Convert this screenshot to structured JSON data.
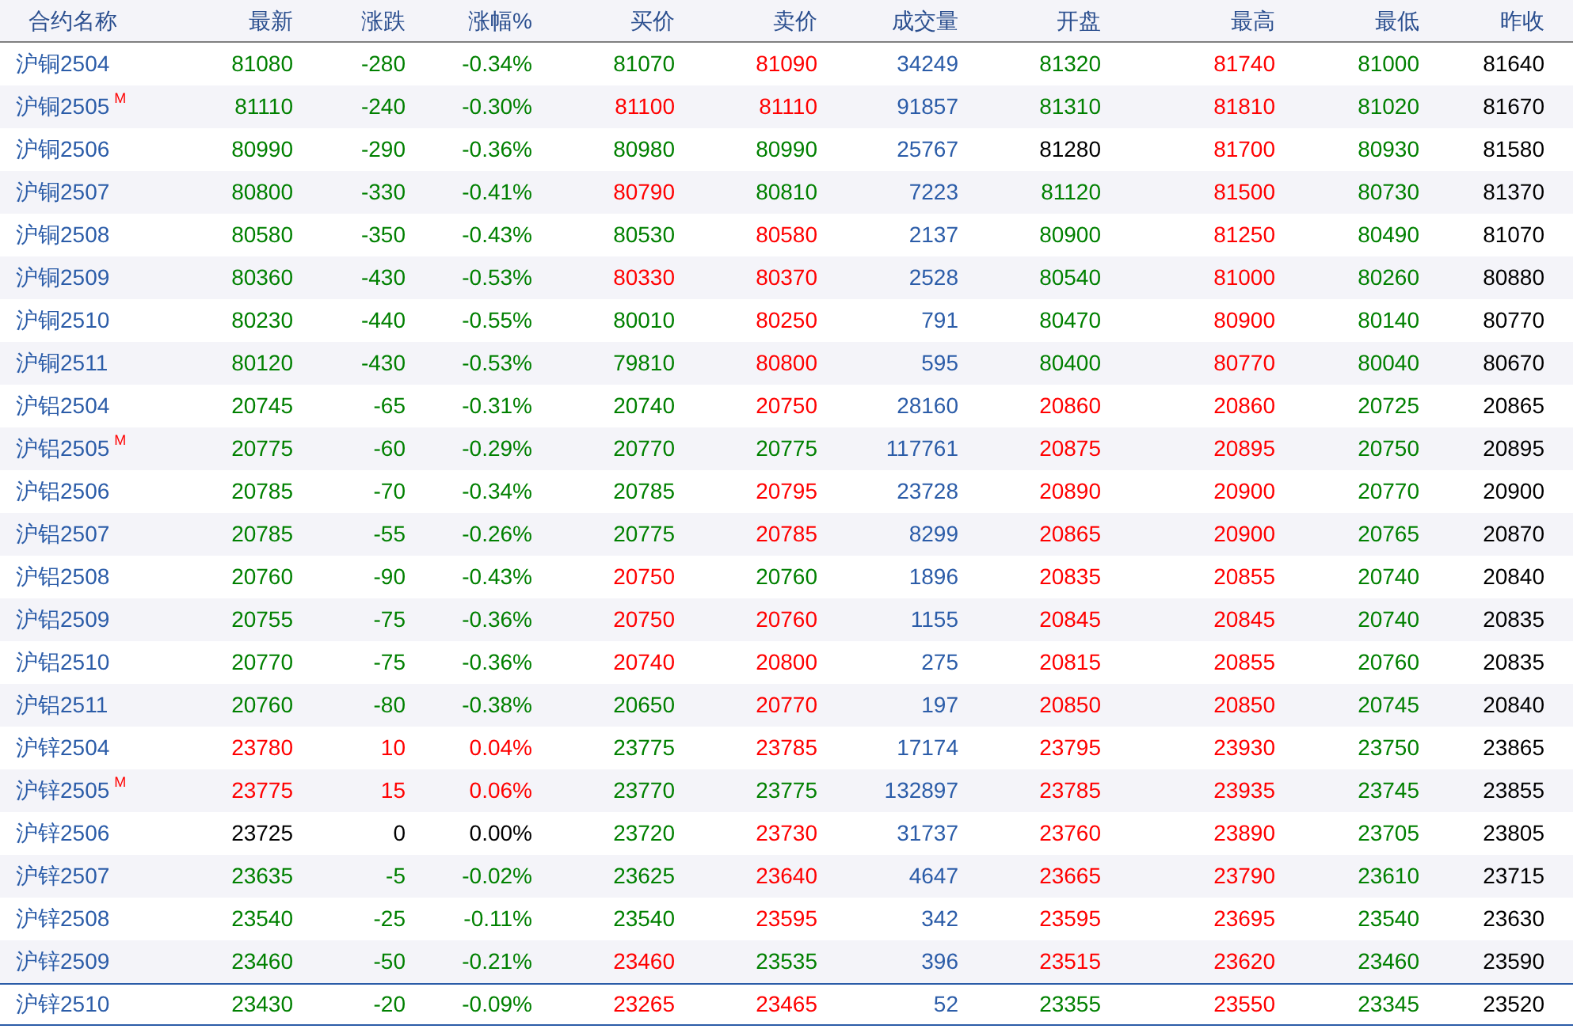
{
  "table": {
    "columns": [
      "合约名称",
      "最新",
      "涨跌",
      "涨幅%",
      "买价",
      "卖价",
      "成交量",
      "开盘",
      "最高",
      "最低",
      "昨收"
    ],
    "rows": [
      {
        "selected": false,
        "cells": [
          {
            "text": "沪铜2504"
          },
          {
            "text": "81080",
            "color": "#008000"
          },
          {
            "text": "-280",
            "color": "#008000"
          },
          {
            "text": "-0.34%",
            "color": "#008000"
          },
          {
            "text": "81070",
            "color": "#008000"
          },
          {
            "text": "81090",
            "color": "#ff0000"
          },
          {
            "text": "34249",
            "color": "#2b5ca8"
          },
          {
            "text": "81320",
            "color": "#008000"
          },
          {
            "text": "81740",
            "color": "#ff0000"
          },
          {
            "text": "81000",
            "color": "#008000"
          },
          {
            "text": "81640",
            "color": "#000000"
          }
        ]
      },
      {
        "selected": false,
        "cells": [
          {
            "text": "沪铜2505",
            "mark": "M"
          },
          {
            "text": "81110",
            "color": "#008000"
          },
          {
            "text": "-240",
            "color": "#008000"
          },
          {
            "text": "-0.30%",
            "color": "#008000"
          },
          {
            "text": "81100",
            "color": "#ff0000"
          },
          {
            "text": "81110",
            "color": "#ff0000"
          },
          {
            "text": "91857",
            "color": "#2b5ca8"
          },
          {
            "text": "81310",
            "color": "#008000"
          },
          {
            "text": "81810",
            "color": "#ff0000"
          },
          {
            "text": "81020",
            "color": "#008000"
          },
          {
            "text": "81670",
            "color": "#000000"
          }
        ]
      },
      {
        "selected": false,
        "cells": [
          {
            "text": "沪铜2506"
          },
          {
            "text": "80990",
            "color": "#008000"
          },
          {
            "text": "-290",
            "color": "#008000"
          },
          {
            "text": "-0.36%",
            "color": "#008000"
          },
          {
            "text": "80980",
            "color": "#008000"
          },
          {
            "text": "80990",
            "color": "#008000"
          },
          {
            "text": "25767",
            "color": "#2b5ca8"
          },
          {
            "text": "81280",
            "color": "#000000"
          },
          {
            "text": "81700",
            "color": "#ff0000"
          },
          {
            "text": "80930",
            "color": "#008000"
          },
          {
            "text": "81580",
            "color": "#000000"
          }
        ]
      },
      {
        "selected": false,
        "cells": [
          {
            "text": "沪铜2507"
          },
          {
            "text": "80800",
            "color": "#008000"
          },
          {
            "text": "-330",
            "color": "#008000"
          },
          {
            "text": "-0.41%",
            "color": "#008000"
          },
          {
            "text": "80790",
            "color": "#ff0000"
          },
          {
            "text": "80810",
            "color": "#008000"
          },
          {
            "text": "7223",
            "color": "#2b5ca8"
          },
          {
            "text": "81120",
            "color": "#008000"
          },
          {
            "text": "81500",
            "color": "#ff0000"
          },
          {
            "text": "80730",
            "color": "#008000"
          },
          {
            "text": "81370",
            "color": "#000000"
          }
        ]
      },
      {
        "selected": false,
        "cells": [
          {
            "text": "沪铜2508"
          },
          {
            "text": "80580",
            "color": "#008000"
          },
          {
            "text": "-350",
            "color": "#008000"
          },
          {
            "text": "-0.43%",
            "color": "#008000"
          },
          {
            "text": "80530",
            "color": "#008000"
          },
          {
            "text": "80580",
            "color": "#ff0000"
          },
          {
            "text": "2137",
            "color": "#2b5ca8"
          },
          {
            "text": "80900",
            "color": "#008000"
          },
          {
            "text": "81250",
            "color": "#ff0000"
          },
          {
            "text": "80490",
            "color": "#008000"
          },
          {
            "text": "81070",
            "color": "#000000"
          }
        ]
      },
      {
        "selected": false,
        "cells": [
          {
            "text": "沪铜2509"
          },
          {
            "text": "80360",
            "color": "#008000"
          },
          {
            "text": "-430",
            "color": "#008000"
          },
          {
            "text": "-0.53%",
            "color": "#008000"
          },
          {
            "text": "80330",
            "color": "#ff0000"
          },
          {
            "text": "80370",
            "color": "#ff0000"
          },
          {
            "text": "2528",
            "color": "#2b5ca8"
          },
          {
            "text": "80540",
            "color": "#008000"
          },
          {
            "text": "81000",
            "color": "#ff0000"
          },
          {
            "text": "80260",
            "color": "#008000"
          },
          {
            "text": "80880",
            "color": "#000000"
          }
        ]
      },
      {
        "selected": false,
        "cells": [
          {
            "text": "沪铜2510"
          },
          {
            "text": "80230",
            "color": "#008000"
          },
          {
            "text": "-440",
            "color": "#008000"
          },
          {
            "text": "-0.55%",
            "color": "#008000"
          },
          {
            "text": "80010",
            "color": "#008000"
          },
          {
            "text": "80250",
            "color": "#ff0000"
          },
          {
            "text": "791",
            "color": "#2b5ca8"
          },
          {
            "text": "80470",
            "color": "#008000"
          },
          {
            "text": "80900",
            "color": "#ff0000"
          },
          {
            "text": "80140",
            "color": "#008000"
          },
          {
            "text": "80770",
            "color": "#000000"
          }
        ]
      },
      {
        "selected": false,
        "cells": [
          {
            "text": "沪铜2511"
          },
          {
            "text": "80120",
            "color": "#008000"
          },
          {
            "text": "-430",
            "color": "#008000"
          },
          {
            "text": "-0.53%",
            "color": "#008000"
          },
          {
            "text": "79810",
            "color": "#008000"
          },
          {
            "text": "80800",
            "color": "#ff0000"
          },
          {
            "text": "595",
            "color": "#2b5ca8"
          },
          {
            "text": "80400",
            "color": "#008000"
          },
          {
            "text": "80770",
            "color": "#ff0000"
          },
          {
            "text": "80040",
            "color": "#008000"
          },
          {
            "text": "80670",
            "color": "#000000"
          }
        ]
      },
      {
        "selected": false,
        "cells": [
          {
            "text": "沪铝2504"
          },
          {
            "text": "20745",
            "color": "#008000"
          },
          {
            "text": "-65",
            "color": "#008000"
          },
          {
            "text": "-0.31%",
            "color": "#008000"
          },
          {
            "text": "20740",
            "color": "#008000"
          },
          {
            "text": "20750",
            "color": "#ff0000"
          },
          {
            "text": "28160",
            "color": "#2b5ca8"
          },
          {
            "text": "20860",
            "color": "#ff0000"
          },
          {
            "text": "20860",
            "color": "#ff0000"
          },
          {
            "text": "20725",
            "color": "#008000"
          },
          {
            "text": "20865",
            "color": "#000000"
          }
        ]
      },
      {
        "selected": false,
        "cells": [
          {
            "text": "沪铝2505",
            "mark": "M"
          },
          {
            "text": "20775",
            "color": "#008000"
          },
          {
            "text": "-60",
            "color": "#008000"
          },
          {
            "text": "-0.29%",
            "color": "#008000"
          },
          {
            "text": "20770",
            "color": "#008000"
          },
          {
            "text": "20775",
            "color": "#008000"
          },
          {
            "text": "117761",
            "color": "#2b5ca8"
          },
          {
            "text": "20875",
            "color": "#ff0000"
          },
          {
            "text": "20895",
            "color": "#ff0000"
          },
          {
            "text": "20750",
            "color": "#008000"
          },
          {
            "text": "20895",
            "color": "#000000"
          }
        ]
      },
      {
        "selected": false,
        "cells": [
          {
            "text": "沪铝2506"
          },
          {
            "text": "20785",
            "color": "#008000"
          },
          {
            "text": "-70",
            "color": "#008000"
          },
          {
            "text": "-0.34%",
            "color": "#008000"
          },
          {
            "text": "20785",
            "color": "#008000"
          },
          {
            "text": "20795",
            "color": "#ff0000"
          },
          {
            "text": "23728",
            "color": "#2b5ca8"
          },
          {
            "text": "20890",
            "color": "#ff0000"
          },
          {
            "text": "20900",
            "color": "#ff0000"
          },
          {
            "text": "20770",
            "color": "#008000"
          },
          {
            "text": "20900",
            "color": "#000000"
          }
        ]
      },
      {
        "selected": false,
        "cells": [
          {
            "text": "沪铝2507"
          },
          {
            "text": "20785",
            "color": "#008000"
          },
          {
            "text": "-55",
            "color": "#008000"
          },
          {
            "text": "-0.26%",
            "color": "#008000"
          },
          {
            "text": "20775",
            "color": "#008000"
          },
          {
            "text": "20785",
            "color": "#ff0000"
          },
          {
            "text": "8299",
            "color": "#2b5ca8"
          },
          {
            "text": "20865",
            "color": "#ff0000"
          },
          {
            "text": "20900",
            "color": "#ff0000"
          },
          {
            "text": "20765",
            "color": "#008000"
          },
          {
            "text": "20870",
            "color": "#000000"
          }
        ]
      },
      {
        "selected": false,
        "cells": [
          {
            "text": "沪铝2508"
          },
          {
            "text": "20760",
            "color": "#008000"
          },
          {
            "text": "-90",
            "color": "#008000"
          },
          {
            "text": "-0.43%",
            "color": "#008000"
          },
          {
            "text": "20750",
            "color": "#ff0000"
          },
          {
            "text": "20760",
            "color": "#008000"
          },
          {
            "text": "1896",
            "color": "#2b5ca8"
          },
          {
            "text": "20835",
            "color": "#ff0000"
          },
          {
            "text": "20855",
            "color": "#ff0000"
          },
          {
            "text": "20740",
            "color": "#008000"
          },
          {
            "text": "20840",
            "color": "#000000"
          }
        ]
      },
      {
        "selected": false,
        "cells": [
          {
            "text": "沪铝2509"
          },
          {
            "text": "20755",
            "color": "#008000"
          },
          {
            "text": "-75",
            "color": "#008000"
          },
          {
            "text": "-0.36%",
            "color": "#008000"
          },
          {
            "text": "20750",
            "color": "#ff0000"
          },
          {
            "text": "20760",
            "color": "#ff0000"
          },
          {
            "text": "1155",
            "color": "#2b5ca8"
          },
          {
            "text": "20845",
            "color": "#ff0000"
          },
          {
            "text": "20845",
            "color": "#ff0000"
          },
          {
            "text": "20740",
            "color": "#008000"
          },
          {
            "text": "20835",
            "color": "#000000"
          }
        ]
      },
      {
        "selected": false,
        "cells": [
          {
            "text": "沪铝2510"
          },
          {
            "text": "20770",
            "color": "#008000"
          },
          {
            "text": "-75",
            "color": "#008000"
          },
          {
            "text": "-0.36%",
            "color": "#008000"
          },
          {
            "text": "20740",
            "color": "#ff0000"
          },
          {
            "text": "20800",
            "color": "#ff0000"
          },
          {
            "text": "275",
            "color": "#2b5ca8"
          },
          {
            "text": "20815",
            "color": "#ff0000"
          },
          {
            "text": "20855",
            "color": "#ff0000"
          },
          {
            "text": "20760",
            "color": "#008000"
          },
          {
            "text": "20835",
            "color": "#000000"
          }
        ]
      },
      {
        "selected": false,
        "cells": [
          {
            "text": "沪铝2511"
          },
          {
            "text": "20760",
            "color": "#008000"
          },
          {
            "text": "-80",
            "color": "#008000"
          },
          {
            "text": "-0.38%",
            "color": "#008000"
          },
          {
            "text": "20650",
            "color": "#008000"
          },
          {
            "text": "20770",
            "color": "#ff0000"
          },
          {
            "text": "197",
            "color": "#2b5ca8"
          },
          {
            "text": "20850",
            "color": "#ff0000"
          },
          {
            "text": "20850",
            "color": "#ff0000"
          },
          {
            "text": "20745",
            "color": "#008000"
          },
          {
            "text": "20840",
            "color": "#000000"
          }
        ]
      },
      {
        "selected": false,
        "cells": [
          {
            "text": "沪锌2504"
          },
          {
            "text": "23780",
            "color": "#ff0000"
          },
          {
            "text": "10",
            "color": "#ff0000"
          },
          {
            "text": "0.04%",
            "color": "#ff0000"
          },
          {
            "text": "23775",
            "color": "#008000"
          },
          {
            "text": "23785",
            "color": "#ff0000"
          },
          {
            "text": "17174",
            "color": "#2b5ca8"
          },
          {
            "text": "23795",
            "color": "#ff0000"
          },
          {
            "text": "23930",
            "color": "#ff0000"
          },
          {
            "text": "23750",
            "color": "#008000"
          },
          {
            "text": "23865",
            "color": "#000000"
          }
        ]
      },
      {
        "selected": false,
        "cells": [
          {
            "text": "沪锌2505",
            "mark": "M"
          },
          {
            "text": "23775",
            "color": "#ff0000"
          },
          {
            "text": "15",
            "color": "#ff0000"
          },
          {
            "text": "0.06%",
            "color": "#ff0000"
          },
          {
            "text": "23770",
            "color": "#008000"
          },
          {
            "text": "23775",
            "color": "#008000"
          },
          {
            "text": "132897",
            "color": "#2b5ca8"
          },
          {
            "text": "23785",
            "color": "#ff0000"
          },
          {
            "text": "23935",
            "color": "#ff0000"
          },
          {
            "text": "23745",
            "color": "#008000"
          },
          {
            "text": "23855",
            "color": "#000000"
          }
        ]
      },
      {
        "selected": false,
        "cells": [
          {
            "text": "沪锌2506"
          },
          {
            "text": "23725",
            "color": "#000000"
          },
          {
            "text": "0",
            "color": "#000000"
          },
          {
            "text": "0.00%",
            "color": "#000000"
          },
          {
            "text": "23720",
            "color": "#008000"
          },
          {
            "text": "23730",
            "color": "#ff0000"
          },
          {
            "text": "31737",
            "color": "#2b5ca8"
          },
          {
            "text": "23760",
            "color": "#ff0000"
          },
          {
            "text": "23890",
            "color": "#ff0000"
          },
          {
            "text": "23705",
            "color": "#008000"
          },
          {
            "text": "23805",
            "color": "#000000"
          }
        ]
      },
      {
        "selected": false,
        "cells": [
          {
            "text": "沪锌2507"
          },
          {
            "text": "23635",
            "color": "#008000"
          },
          {
            "text": "-5",
            "color": "#008000"
          },
          {
            "text": "-0.02%",
            "color": "#008000"
          },
          {
            "text": "23625",
            "color": "#008000"
          },
          {
            "text": "23640",
            "color": "#ff0000"
          },
          {
            "text": "4647",
            "color": "#2b5ca8"
          },
          {
            "text": "23665",
            "color": "#ff0000"
          },
          {
            "text": "23790",
            "color": "#ff0000"
          },
          {
            "text": "23610",
            "color": "#008000"
          },
          {
            "text": "23715",
            "color": "#000000"
          }
        ]
      },
      {
        "selected": false,
        "cells": [
          {
            "text": "沪锌2508"
          },
          {
            "text": "23540",
            "color": "#008000"
          },
          {
            "text": "-25",
            "color": "#008000"
          },
          {
            "text": "-0.11%",
            "color": "#008000"
          },
          {
            "text": "23540",
            "color": "#008000"
          },
          {
            "text": "23595",
            "color": "#ff0000"
          },
          {
            "text": "342",
            "color": "#2b5ca8"
          },
          {
            "text": "23595",
            "color": "#ff0000"
          },
          {
            "text": "23695",
            "color": "#ff0000"
          },
          {
            "text": "23540",
            "color": "#008000"
          },
          {
            "text": "23630",
            "color": "#000000"
          }
        ]
      },
      {
        "selected": false,
        "cells": [
          {
            "text": "沪锌2509"
          },
          {
            "text": "23460",
            "color": "#008000"
          },
          {
            "text": "-50",
            "color": "#008000"
          },
          {
            "text": "-0.21%",
            "color": "#008000"
          },
          {
            "text": "23460",
            "color": "#ff0000"
          },
          {
            "text": "23535",
            "color": "#008000"
          },
          {
            "text": "396",
            "color": "#2b5ca8"
          },
          {
            "text": "23515",
            "color": "#ff0000"
          },
          {
            "text": "23620",
            "color": "#ff0000"
          },
          {
            "text": "23460",
            "color": "#008000"
          },
          {
            "text": "23590",
            "color": "#000000"
          }
        ]
      },
      {
        "selected": true,
        "cells": [
          {
            "text": "沪锌2510"
          },
          {
            "text": "23430",
            "color": "#008000"
          },
          {
            "text": "-20",
            "color": "#008000"
          },
          {
            "text": "-0.09%",
            "color": "#008000"
          },
          {
            "text": "23265",
            "color": "#ff0000"
          },
          {
            "text": "23465",
            "color": "#ff0000"
          },
          {
            "text": "52",
            "color": "#2b5ca8"
          },
          {
            "text": "23355",
            "color": "#008000"
          },
          {
            "text": "23550",
            "color": "#ff0000"
          },
          {
            "text": "23345",
            "color": "#008000"
          },
          {
            "text": "23520",
            "color": "#000000"
          }
        ]
      }
    ]
  }
}
